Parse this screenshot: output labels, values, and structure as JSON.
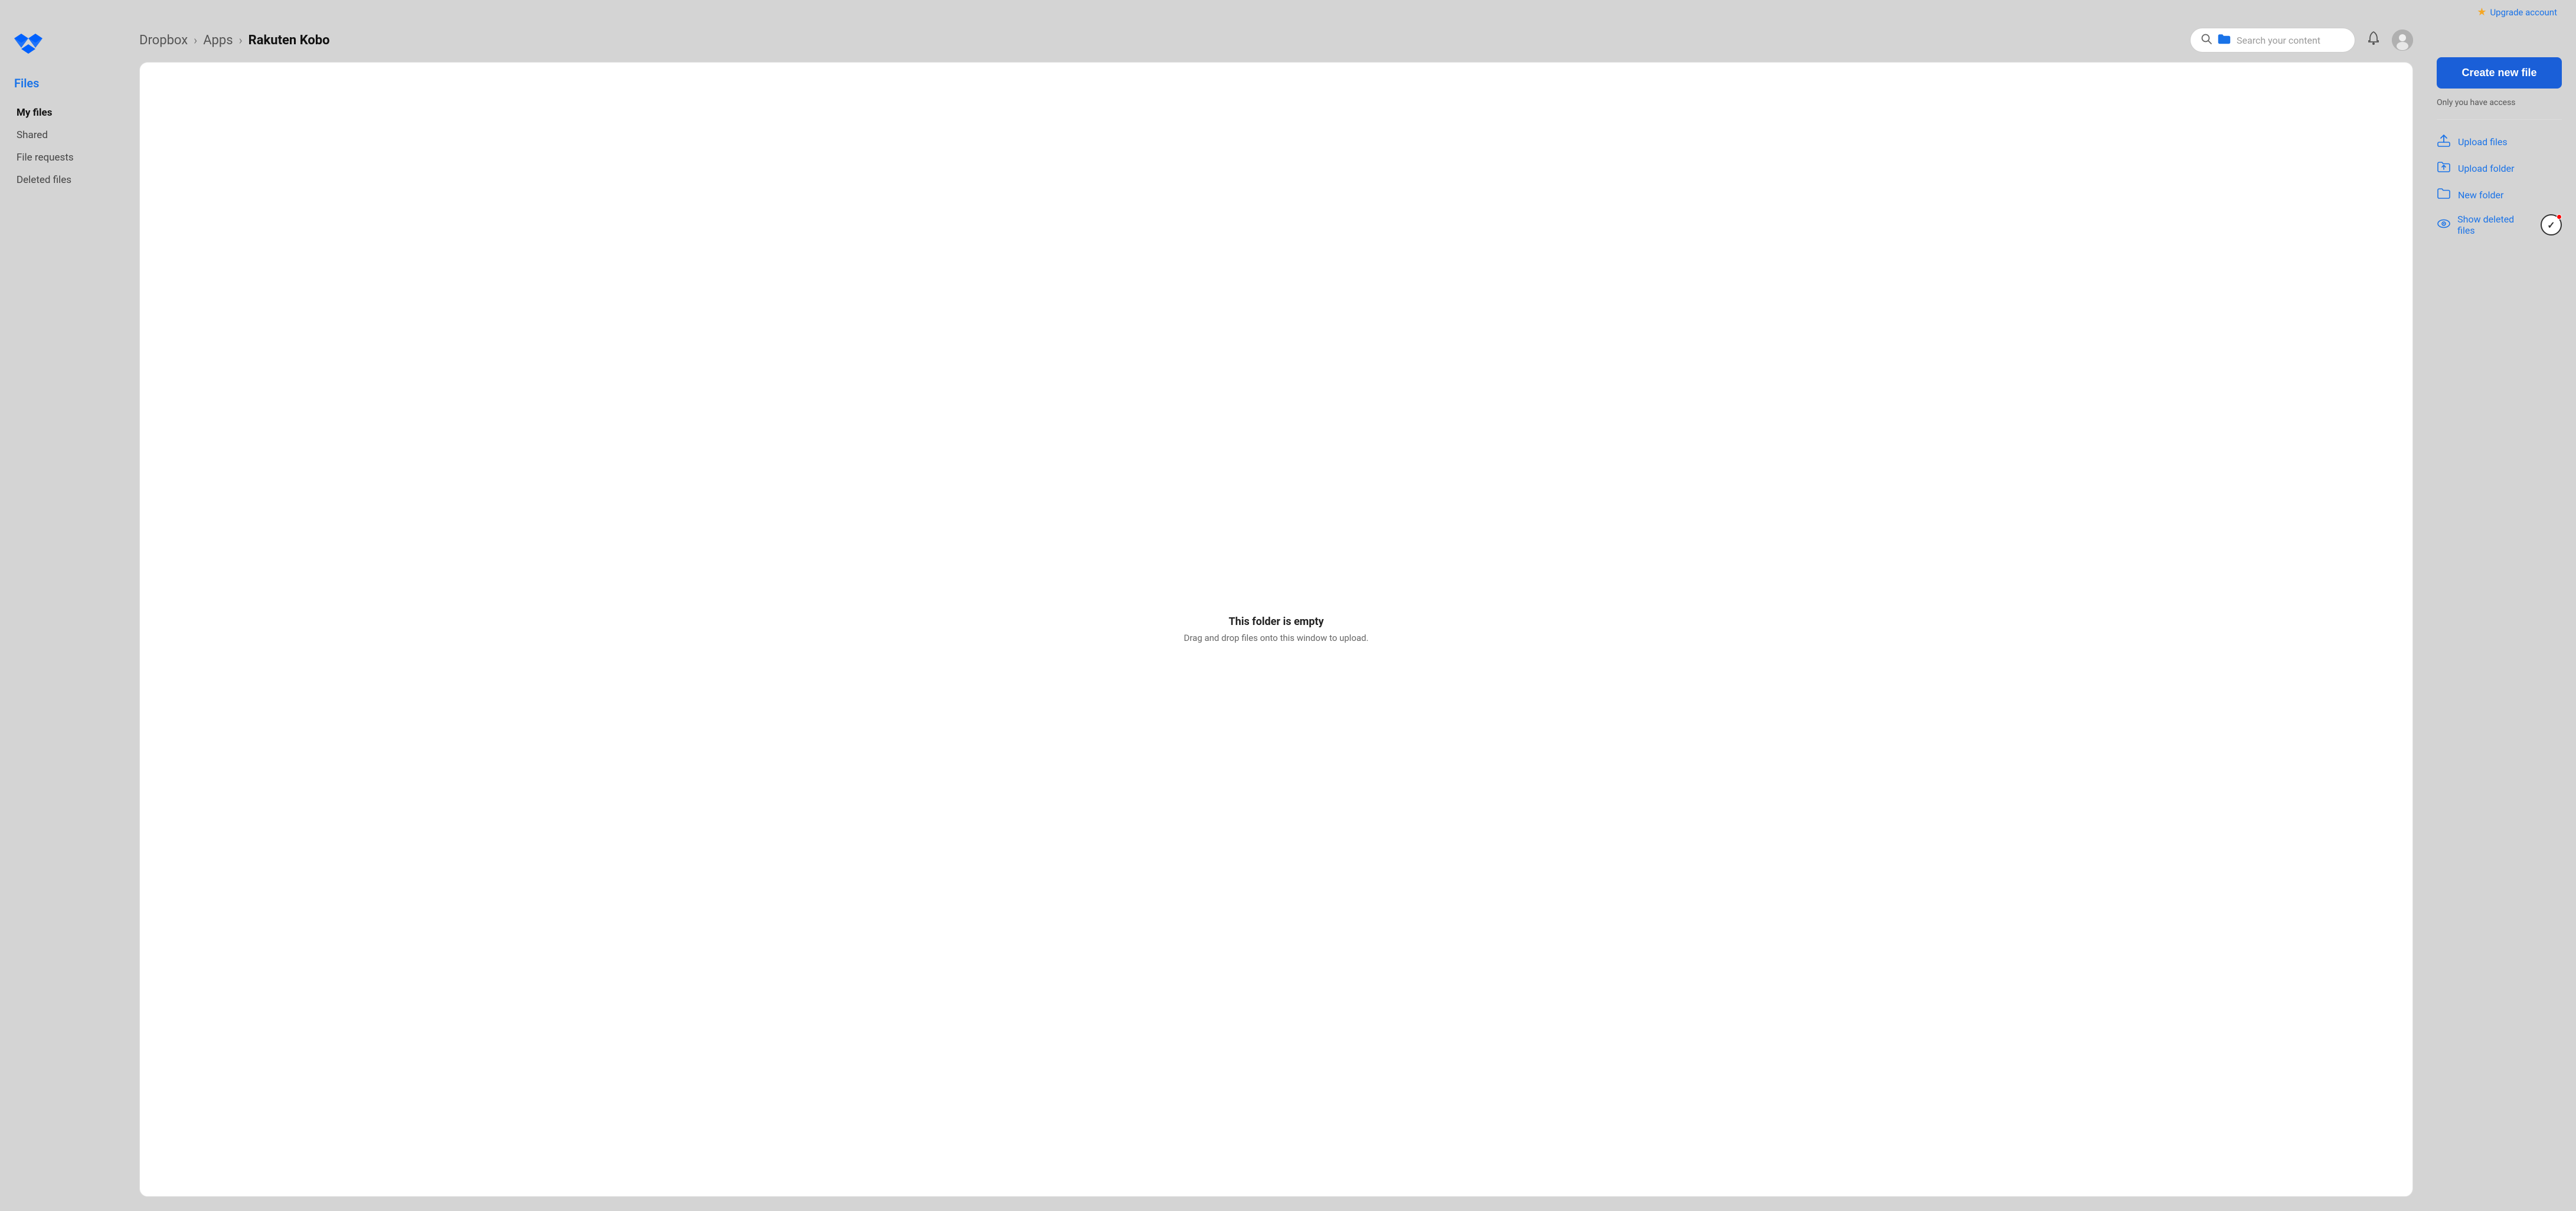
{
  "topbar": {
    "upgrade_label": "Upgrade account"
  },
  "sidebar": {
    "section_title": "Files",
    "nav_items": [
      {
        "label": "My files",
        "active": true,
        "id": "my-files"
      },
      {
        "label": "Shared",
        "active": false,
        "id": "shared"
      },
      {
        "label": "File requests",
        "active": false,
        "id": "file-requests"
      },
      {
        "label": "Deleted files",
        "active": false,
        "id": "deleted-files"
      }
    ]
  },
  "header": {
    "breadcrumb": [
      {
        "label": "Dropbox",
        "current": false
      },
      {
        "label": "Apps",
        "current": false
      },
      {
        "label": "Rakuten Kobo",
        "current": true
      }
    ],
    "search_placeholder": "Search your content"
  },
  "empty_state": {
    "title": "This folder is empty",
    "subtitle": "Drag and drop files onto this window to upload."
  },
  "right_panel": {
    "create_button_label": "Create new file",
    "access_label": "Only you have access",
    "actions": [
      {
        "label": "Upload files",
        "icon": "upload-files-icon",
        "id": "upload-files"
      },
      {
        "label": "Upload folder",
        "icon": "upload-folder-icon",
        "id": "upload-folder"
      },
      {
        "label": "New folder",
        "icon": "new-folder-icon",
        "id": "new-folder"
      },
      {
        "label": "Show deleted files",
        "icon": "show-deleted-icon",
        "id": "show-deleted"
      }
    ]
  },
  "icons": {
    "star": "★",
    "search": "🔍",
    "bell": "🔔",
    "chevron_right": "›",
    "upload": "⬆",
    "folder": "📁",
    "eye": "👁",
    "check": "✓"
  }
}
